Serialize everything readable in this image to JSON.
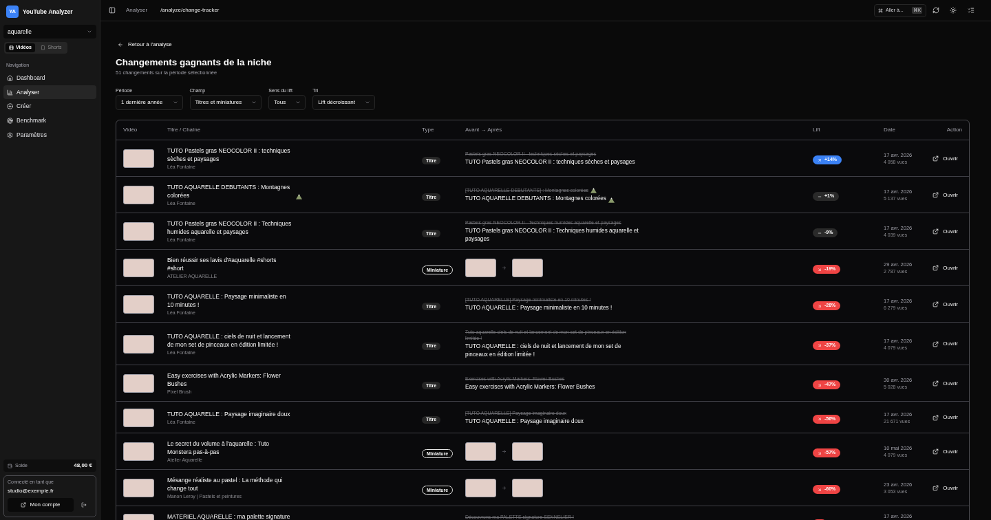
{
  "sidebar": {
    "logo": "YA",
    "app_name": "YouTube Analyzer",
    "niche_select": {
      "value": "aquarelle"
    },
    "format_toggle": [
      {
        "label": "Vidéos",
        "selected": true
      },
      {
        "label": "Shorts",
        "selected": false
      }
    ],
    "section_label": "Navigation",
    "items": [
      {
        "label": "Dashboard",
        "selected": false
      },
      {
        "label": "Analyser",
        "selected": true
      },
      {
        "label": "Créer",
        "selected": false
      },
      {
        "label": "Benchmark",
        "selected": false
      },
      {
        "label": "Paramètres",
        "selected": false
      }
    ],
    "balance": {
      "label": "Solde",
      "value": "48,00 €"
    },
    "account": {
      "caption": "Connecté en tant que",
      "email": "studio@exemple.fr",
      "button": "Mon compte"
    }
  },
  "topbar": {
    "breadcrumb": [
      "Analyser",
      "/analyze/change-tracker"
    ],
    "command": {
      "label": "Aller à...",
      "shortcut": "⌘K"
    }
  },
  "page": {
    "back_link": "Retour à l'analyse",
    "title": "Changements gagnants de la niche",
    "subtitle": "51 changements sur la période sélectionnée",
    "filters": [
      {
        "label": "Période",
        "value": "1 dernière année"
      },
      {
        "label": "Champ",
        "value": "Titres et miniatures"
      },
      {
        "label": "Sens du lift",
        "value": "Tous"
      },
      {
        "label": "Tri",
        "value": "Lift décroissant"
      }
    ]
  },
  "table": {
    "columns": [
      "Vidéo",
      "Titre / Chaîne",
      "Type",
      "Avant → Après",
      "Lift",
      "Date",
      "Action"
    ],
    "rows": [
      {
        "title": "TUTO Pastels gras NEOCOLOR II : techniques sèches et paysages",
        "channel": "Léa Fontaine",
        "type": "Titre",
        "change": {
          "kind": "title",
          "before": "Pastels gras NEOCOLOR II - techniques sèches et paysages",
          "after": "TUTO Pastels gras NEOCOLOR II : techniques sèches et paysages"
        },
        "lift": {
          "kind": "up",
          "value": "+14%"
        },
        "date": "17 avr. 2026",
        "views": "4 058 vues",
        "action": "Ouvrir"
      },
      {
        "title": "TUTO AQUARELLE DEBUTANTS : Montagnes colorées",
        "title_emoji": true,
        "channel": "Léa Fontaine",
        "type": "Titre",
        "change": {
          "kind": "title",
          "before": "[TUTO AQUARELLE DEBUTANTS] : Montagnes colorées",
          "before_emoji": true,
          "after": "TUTO AQUARELLE DEBUTANTS : Montagnes colorées",
          "after_emoji": true
        },
        "lift": {
          "kind": "neutral",
          "value": "+1%"
        },
        "date": "17 avr. 2026",
        "views": "5 137 vues",
        "action": "Ouvrir"
      },
      {
        "title": "TUTO Pastels gras NEOCOLOR II : Techniques humides aquarelle et paysages",
        "channel": "Léa Fontaine",
        "type": "Titre",
        "change": {
          "kind": "title",
          "before": "Pastels gras NEOCOLOR II - Techniques humides aquarelle et paysages",
          "after": "TUTO Pastels gras NEOCOLOR II : Techniques humides aquarelle et paysages"
        },
        "lift": {
          "kind": "neutral",
          "value": "-9%"
        },
        "date": "17 avr. 2026",
        "views": "4 039 vues",
        "action": "Ouvrir"
      },
      {
        "title": "Bien réussir ses lavis d'#aquarelle #shorts #short",
        "channel": "ATELIER AQUARELLE",
        "type": "Miniature",
        "change": {
          "kind": "thumbnail"
        },
        "lift": {
          "kind": "down",
          "value": "-19%"
        },
        "date": "29 avr. 2026",
        "views": "2 787 vues",
        "action": "Ouvrir"
      },
      {
        "title": "TUTO AQUARELLE : Paysage minimaliste en 10 minutes !",
        "channel": "Léa Fontaine",
        "type": "Titre",
        "change": {
          "kind": "title",
          "before": "[TUTO AQUARELLE] Paysage minimaliste en 10 minutes !",
          "after": "TUTO AQUARELLE : Paysage minimaliste en 10 minutes !"
        },
        "lift": {
          "kind": "down",
          "value": "-28%"
        },
        "date": "17 avr. 2026",
        "views": "6 279 vues",
        "action": "Ouvrir"
      },
      {
        "title": "TUTO AQUARELLE : ciels de nuit et lancement de mon set de pinceaux en édition limitée !",
        "channel": "Léa Fontaine",
        "type": "Titre",
        "change": {
          "kind": "title",
          "before": "Tuto aquarelle ciels de nuit et lancement de mon set de pinceaux en édition limitée !",
          "after": "TUTO AQUARELLE : ciels de nuit et lancement de mon set de pinceaux en édition limitée !"
        },
        "lift": {
          "kind": "down",
          "value": "-37%"
        },
        "date": "17 avr. 2026",
        "views": "4 079 vues",
        "action": "Ouvrir"
      },
      {
        "title": "Easy exercises with Acrylic Markers: Flower Bushes",
        "channel": "Pixel Brush",
        "type": "Titre",
        "change": {
          "kind": "title",
          "before": "Exercises with Acrylic Markers: Flower Bushes",
          "after": "Easy exercises with Acrylic Markers: Flower Bushes"
        },
        "lift": {
          "kind": "down",
          "value": "-47%"
        },
        "date": "30 avr. 2026",
        "views": "5 028 vues",
        "action": "Ouvrir"
      },
      {
        "title": "TUTO AQUARELLE : Paysage imaginaire doux",
        "channel": "Léa Fontaine",
        "type": "Titre",
        "change": {
          "kind": "title",
          "before": "[TUTO AQUARELLE] Paysage imaginaire doux",
          "after": "TUTO AQUARELLE : Paysage imaginaire doux"
        },
        "lift": {
          "kind": "down",
          "value": "-56%"
        },
        "date": "17 avr. 2026",
        "views": "21 671 vues",
        "action": "Ouvrir"
      },
      {
        "title": "Le secret du volume à l'aquarelle : Tuto Monstera pas-à-pas",
        "channel": "Atelier Aquarelle",
        "type": "Miniature",
        "change": {
          "kind": "thumbnail"
        },
        "lift": {
          "kind": "down",
          "value": "-57%"
        },
        "date": "10 mai 2026",
        "views": "4 079 vues",
        "action": "Ouvrir"
      },
      {
        "title": "Mésange réaliste au pastel : La méthode qui change tout",
        "channel": "Manon Leroy | Pastels et peintures",
        "type": "Miniature",
        "change": {
          "kind": "thumbnail"
        },
        "lift": {
          "kind": "down",
          "value": "-60%"
        },
        "date": "23 avr. 2026",
        "views": "3 053 vues",
        "action": "Ouvrir"
      },
      {
        "title": "MATERIEL AQUARELLE : ma palette signature",
        "change": {
          "kind": "title",
          "before": "Découvrons ma PALETTE signature SENNELIER !"
        },
        "lift": {
          "kind": "down"
        },
        "date": "17 avr. 2026"
      }
    ]
  }
}
